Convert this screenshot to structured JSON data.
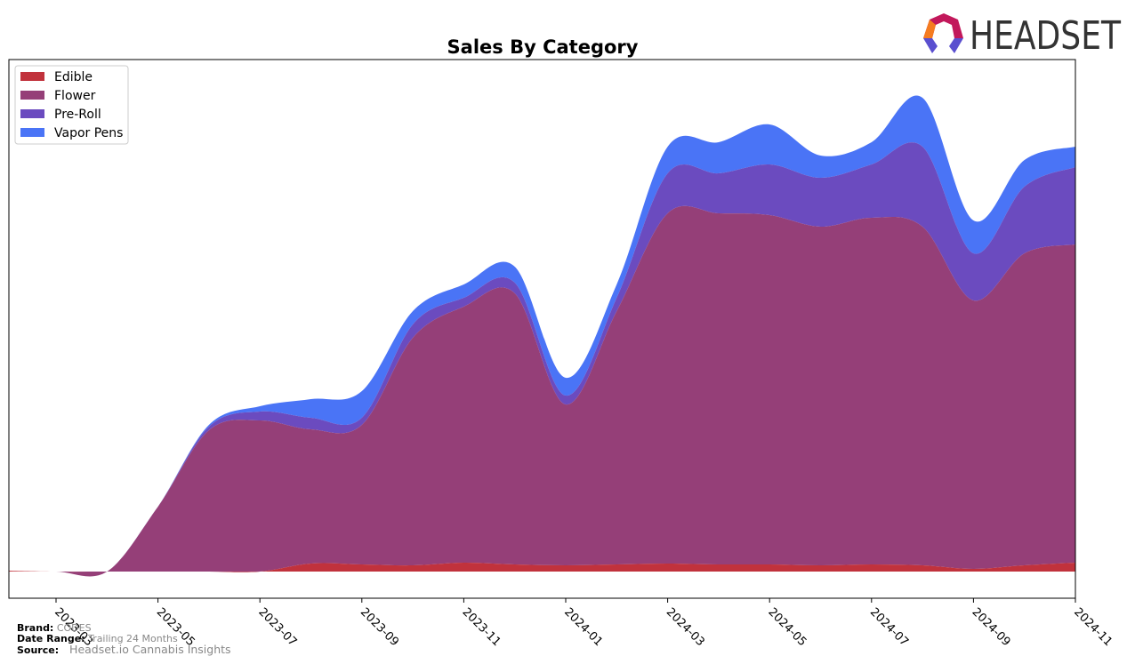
{
  "chart_data": {
    "type": "area",
    "stacked": true,
    "title": "Sales By Category",
    "xlabel": "",
    "ylabel": "",
    "x": [
      "2023-02",
      "2023-03",
      "2023-04",
      "2023-05",
      "2023-06",
      "2023-07",
      "2023-08",
      "2023-09",
      "2023-10",
      "2023-11",
      "2023-12",
      "2024-01",
      "2024-02",
      "2024-03",
      "2024-04",
      "2024-05",
      "2024-06",
      "2024-07",
      "2024-08",
      "2024-09",
      "2024-10",
      "2024-11"
    ],
    "xticks": [
      "2023-03",
      "2023-05",
      "2023-07",
      "2023-09",
      "2023-11",
      "2024-01",
      "2024-03",
      "2024-05",
      "2024-07",
      "2024-09",
      "2024-11"
    ],
    "ylim": [
      -30,
      576
    ],
    "y_axis_visible": false,
    "grid": false,
    "legend_position": "top-left",
    "series": [
      {
        "name": "Edible",
        "color": "#c1323c",
        "values": [
          1,
          0,
          0,
          0,
          0,
          0,
          9,
          8,
          7,
          10,
          8,
          7,
          8,
          9,
          8,
          8,
          7,
          8,
          7,
          3,
          7,
          10
        ]
      },
      {
        "name": "Flower",
        "color": "#953f78",
        "values": [
          0,
          0,
          0,
          73,
          159,
          170,
          151,
          157,
          256,
          288,
          305,
          181,
          285,
          394,
          395,
          393,
          381,
          390,
          381,
          302,
          351,
          358
        ]
      },
      {
        "name": "Pre-Roll",
        "color": "#6b4bbf",
        "values": [
          0,
          0,
          0,
          0,
          4,
          10,
          13,
          8,
          15,
          10,
          12,
          10,
          15,
          45,
          45,
          57,
          55,
          60,
          90,
          53,
          75,
          87
        ]
      },
      {
        "name": "Vapor Pens",
        "color": "#4a74f6",
        "values": [
          0,
          0,
          0,
          0,
          2,
          6,
          21,
          30,
          15,
          15,
          18,
          20,
          15,
          30,
          35,
          45,
          25,
          25,
          55,
          37,
          30,
          23
        ]
      }
    ]
  },
  "logo": {
    "text": "HEADSET"
  },
  "footer": {
    "brand_label": "Brand:",
    "brand_value": "CODES",
    "date_label": "Date Range:",
    "date_value": "Trailing 24 Months",
    "source_label": "Source:",
    "source_value": "Headset.io Cannabis Insights"
  }
}
